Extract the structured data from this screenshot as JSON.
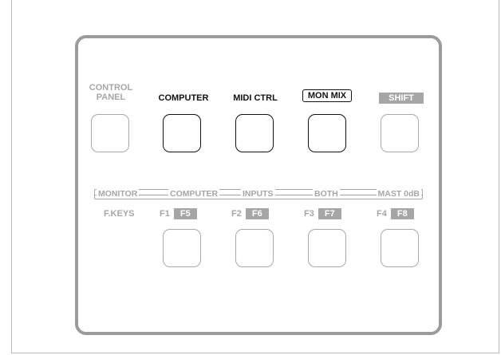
{
  "top_labels": {
    "control_panel_line1": "CONTROL",
    "control_panel_line2": "PANEL",
    "computer": "COMPUTER",
    "midi_ctrl": "MIDI CTRL",
    "mon_mix": "MON MIX",
    "shift": "SHIFT"
  },
  "monitor_strip": {
    "monitor": "MONITOR",
    "computer": "COMPUTER",
    "inputs": "INPUTS",
    "both": "BOTH",
    "mast": "MAST 0dB"
  },
  "fkeys": {
    "label": "F.KEYS",
    "k1": "F1",
    "k1_alt": "F5",
    "k2": "F2",
    "k2_alt": "F6",
    "k3": "F3",
    "k3_alt": "F7",
    "k4": "F4",
    "k4_alt": "F8"
  },
  "colors": {
    "active": "#111111",
    "inactive": "#a6a6a6",
    "panel_border": "#9b9b9b"
  }
}
